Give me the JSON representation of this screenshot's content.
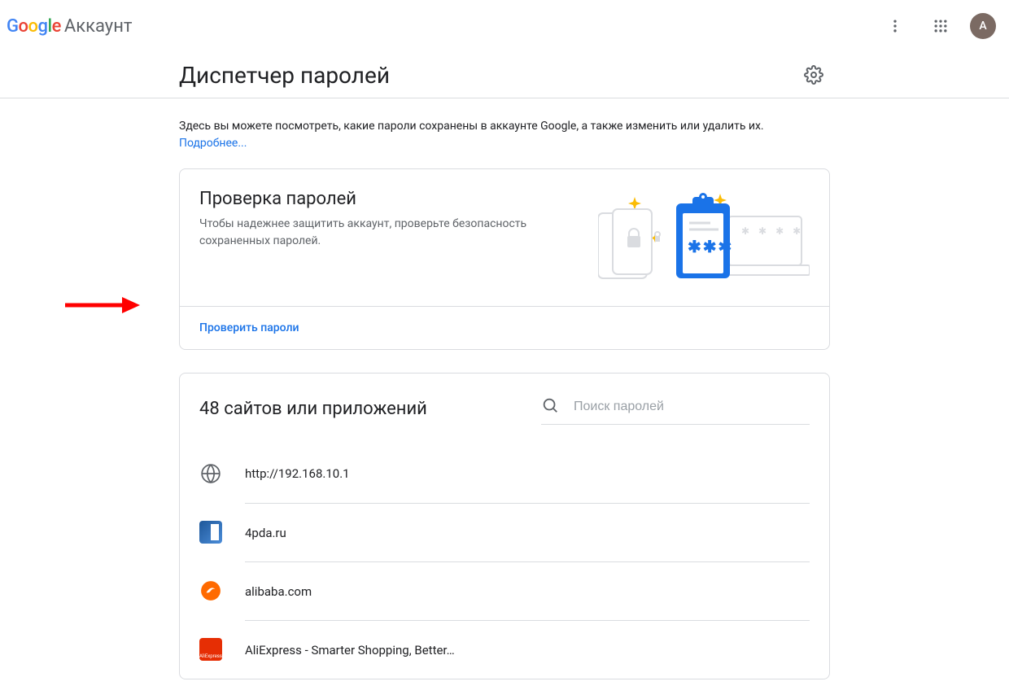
{
  "header": {
    "logo_letters": [
      "G",
      "o",
      "o",
      "g",
      "l",
      "e"
    ],
    "account_label": "Аккаунт",
    "avatar_initial": "А"
  },
  "page": {
    "title": "Диспетчер паролей",
    "intro_text": "Здесь вы можете посмотреть, какие пароли сохранены в аккаунте Google, а также изменить или удалить их.",
    "intro_link": "Подробнее..."
  },
  "checkup_card": {
    "title": "Проверка паролей",
    "subtitle": "Чтобы надежнее защитить аккаунт, проверьте безопасность сохраненных паролей.",
    "action": "Проверить пароли",
    "illustration_asterisks": "✱✱✱"
  },
  "password_list": {
    "count": 48,
    "title_suffix": "сайтов или приложений",
    "search_placeholder": "Поиск паролей",
    "items": [
      {
        "icon": "globe",
        "label": "http://192.168.10.1"
      },
      {
        "icon": "4pda",
        "label": "4pda.ru"
      },
      {
        "icon": "alibaba",
        "label": "alibaba.com"
      },
      {
        "icon": "aliexpress",
        "label": "AliExpress - Smarter Shopping, Better…"
      }
    ]
  }
}
